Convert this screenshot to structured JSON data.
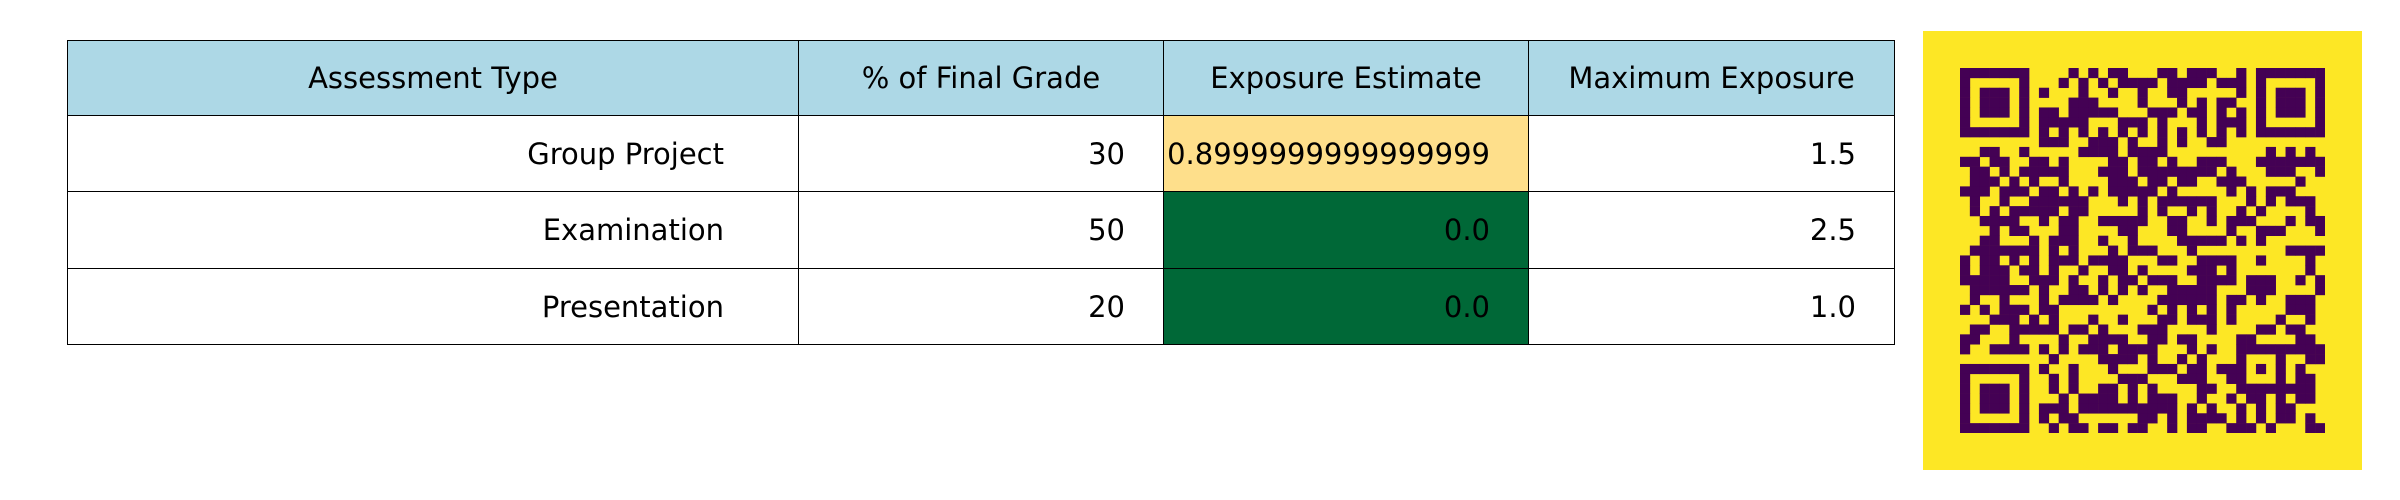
{
  "chart_data": {
    "type": "table",
    "columns": [
      "Assessment Type",
      "% of Final Grade",
      "Exposure Estimate",
      "Maximum Exposure"
    ],
    "rows": [
      [
        "Group Project",
        "30",
        "0.8999999999999999",
        "1.5"
      ],
      [
        "Examination",
        "50",
        "0.0",
        "2.5"
      ],
      [
        "Presentation",
        "20",
        "0.0",
        "1.0"
      ]
    ],
    "header_color": "#add8e6",
    "exposure_cell_colors": [
      "#fedf8b",
      "#006837",
      "#006837"
    ]
  },
  "qr": {
    "foreground": "#440154",
    "background": "#fde725"
  }
}
